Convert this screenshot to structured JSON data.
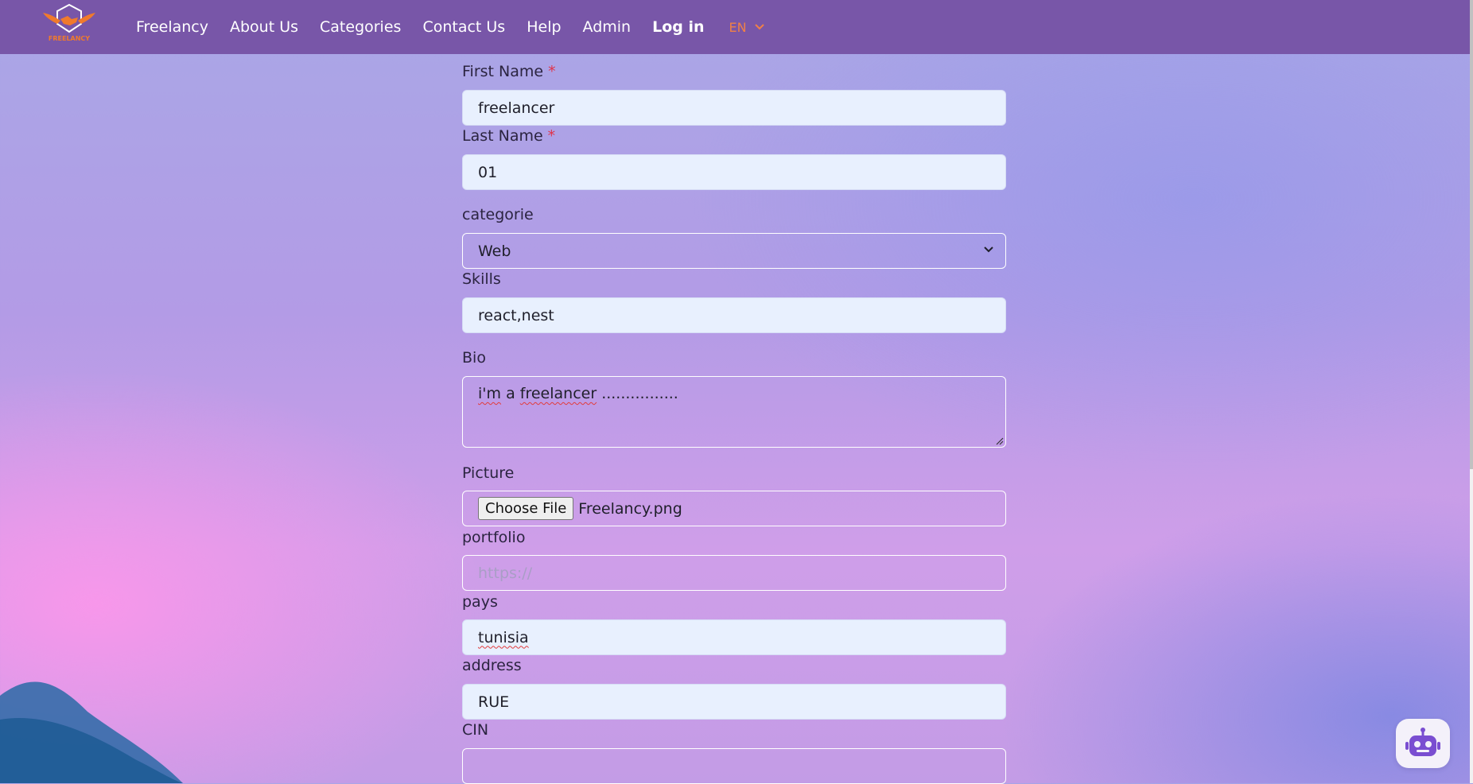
{
  "nav": {
    "logo_text": "FREELANCY",
    "links": [
      "Freelancy",
      "About Us",
      "Categories",
      "Contact Us",
      "Help",
      "Admin"
    ],
    "login": "Log in",
    "language": "EN"
  },
  "form": {
    "first_name": {
      "label": "First Name",
      "required_mark": "*",
      "value": "freelancer"
    },
    "last_name": {
      "label": "Last Name",
      "required_mark": "*",
      "value": "01"
    },
    "categorie": {
      "label": "categorie",
      "value": "Web"
    },
    "skills": {
      "label": "Skills",
      "value": "react,nest"
    },
    "bio": {
      "label": "Bio",
      "value_words": [
        "i'm",
        "a",
        "freelancer",
        "................"
      ]
    },
    "picture": {
      "label": "Picture",
      "button": "Choose File",
      "file_name": "Freelancy.png"
    },
    "portfolio": {
      "label": "portfolio",
      "placeholder": "https://"
    },
    "pays": {
      "label": "pays",
      "value": "tunisia"
    },
    "address": {
      "label": "address",
      "value": "RUE"
    },
    "cin": {
      "label": "CIN",
      "value": ""
    }
  },
  "colors": {
    "navbar": "#7856a8",
    "lang_accent": "#f08046",
    "required": "#e0334a",
    "input_fill": "#e8f0fe",
    "chatbot_icon": "#7a4ed1"
  },
  "icons": {
    "language_dropdown": "chevron-down-icon",
    "select": "chevron-down-icon",
    "chatbot": "robot-icon",
    "logo": "handshake-shield-logo"
  }
}
